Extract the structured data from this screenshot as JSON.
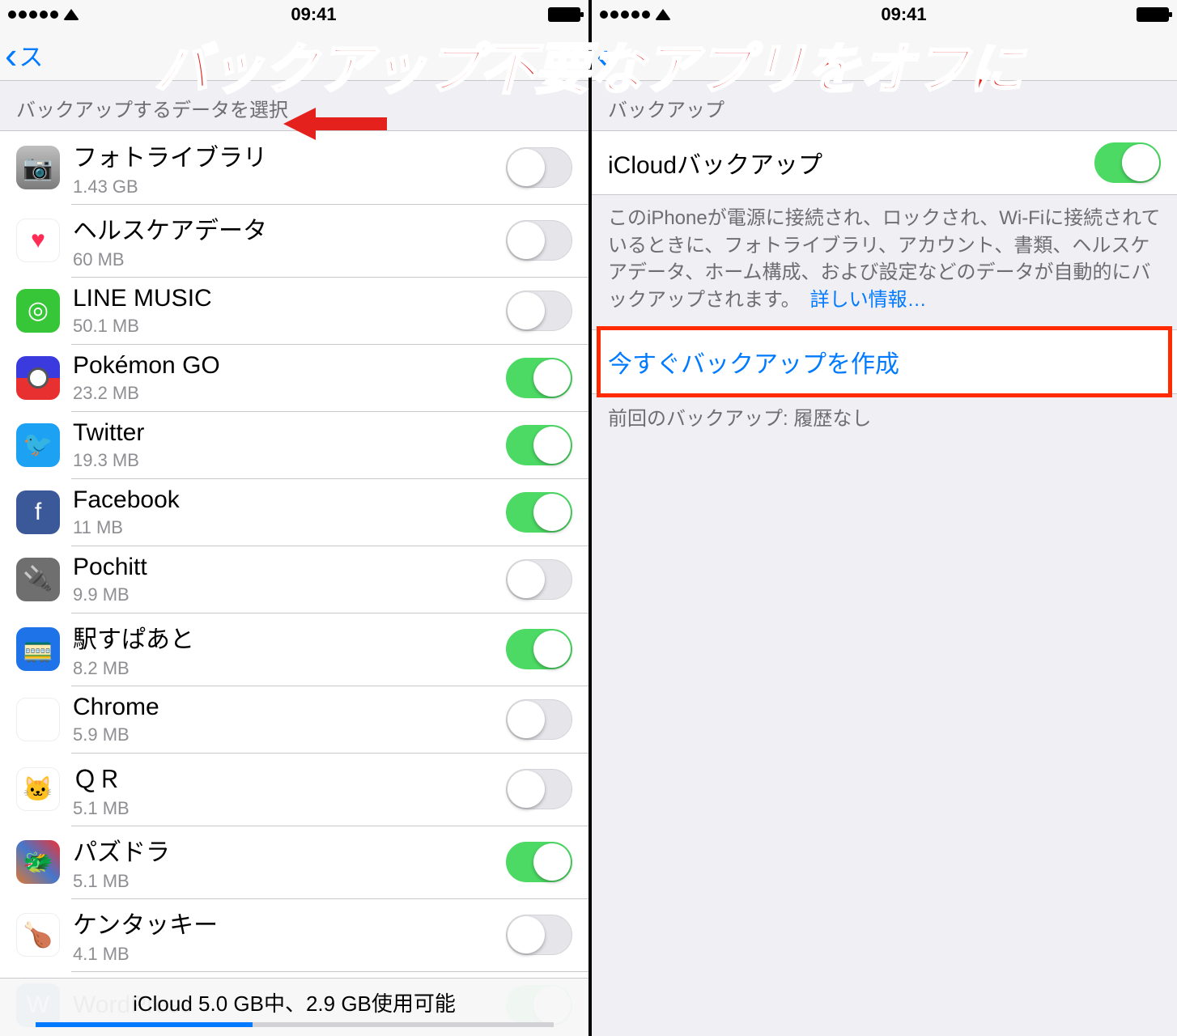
{
  "overlay_text": "バックアップ不要なアプリをオフに",
  "statusbar": {
    "time": "09:41"
  },
  "left": {
    "back_label": "ス",
    "section_header": "バックアップするデータを選択",
    "apps": [
      {
        "name": "フォトライブラリ",
        "size": "1.43 GB",
        "on": false,
        "icon": "ic-photos",
        "glyph": "📷"
      },
      {
        "name": "ヘルスケアデータ",
        "size": "60 MB",
        "on": false,
        "icon": "ic-health",
        "glyph": "♥"
      },
      {
        "name": "LINE MUSIC",
        "size": "50.1 MB",
        "on": false,
        "icon": "ic-line",
        "glyph": "◎"
      },
      {
        "name": "Pokémon GO",
        "size": "23.2 MB",
        "on": true,
        "icon": "ic-pokemon",
        "glyph": ""
      },
      {
        "name": "Twitter",
        "size": "19.3 MB",
        "on": true,
        "icon": "ic-twitter",
        "glyph": "🐦"
      },
      {
        "name": "Facebook",
        "size": "11 MB",
        "on": true,
        "icon": "ic-facebook",
        "glyph": "f"
      },
      {
        "name": "Pochitt",
        "size": "9.9 MB",
        "on": false,
        "icon": "ic-pochitt",
        "glyph": "🔌"
      },
      {
        "name": "駅すぱあと",
        "size": "8.2 MB",
        "on": true,
        "icon": "ic-eki",
        "glyph": "🚃"
      },
      {
        "name": "Chrome",
        "size": "5.9 MB",
        "on": false,
        "icon": "ic-chrome",
        "glyph": "◉"
      },
      {
        "name": "ＱＲ",
        "size": "5.1 MB",
        "on": false,
        "icon": "ic-qr",
        "glyph": "🐱"
      },
      {
        "name": "パズドラ",
        "size": "5.1 MB",
        "on": true,
        "icon": "ic-pad",
        "glyph": "🐲"
      },
      {
        "name": "ケンタッキー",
        "size": "4.1 MB",
        "on": false,
        "icon": "ic-kfc",
        "glyph": "🍗"
      },
      {
        "name": "WordPress",
        "size": "",
        "on": true,
        "icon": "ic-wp",
        "glyph": "W"
      }
    ],
    "storage_text": "iCloud 5.0 GB中、2.9 GB使用可能",
    "storage_used_pct": 42
  },
  "right": {
    "section_header": "バックアップ",
    "icloud_backup_label": "iCloudバックアップ",
    "icloud_backup_on": true,
    "footer_text": "このiPhoneが電源に接続され、ロックされ、Wi-Fiに接続されているときに、フォトライブラリ、アカウント、書類、ヘルスケアデータ、ホーム構成、および設定などのデータが自動的にバックアップされます。　",
    "footer_link": "詳しい情報…",
    "backup_now": "今すぐバックアップを作成",
    "last_backup": "前回のバックアップ: 履歴なし"
  }
}
